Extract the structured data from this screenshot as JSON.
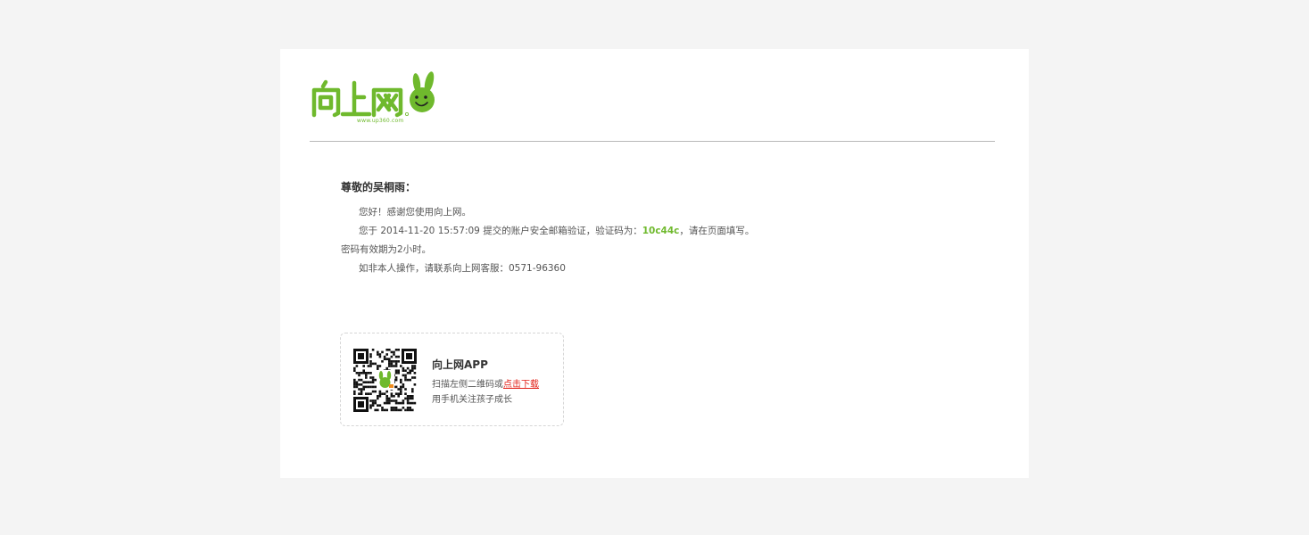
{
  "brand": {
    "logo_text": "向上网",
    "url": "www.up360.com",
    "color": "#6fb92d"
  },
  "email": {
    "greeting": "尊敬的吴桐雨：",
    "line1": "您好！感谢您使用向上网。",
    "line2_prefix": "您于 2014-11-20 15:57:09 提交的账户安全邮箱验证，验证码为：",
    "verification_code": "10c44c",
    "line2_suffix": "，请在页面填写。",
    "line3": "密码有效期为2小时。",
    "line4": "如非本人操作，请联系向上网客服：0571-96360"
  },
  "app": {
    "title": "向上网APP",
    "desc1_prefix": "扫描左侧二维码或",
    "download_link": "点击下载",
    "desc2": "用手机关注孩子成长",
    "qr_icon": "qr-code-icon",
    "link_color": "#e2231a"
  }
}
